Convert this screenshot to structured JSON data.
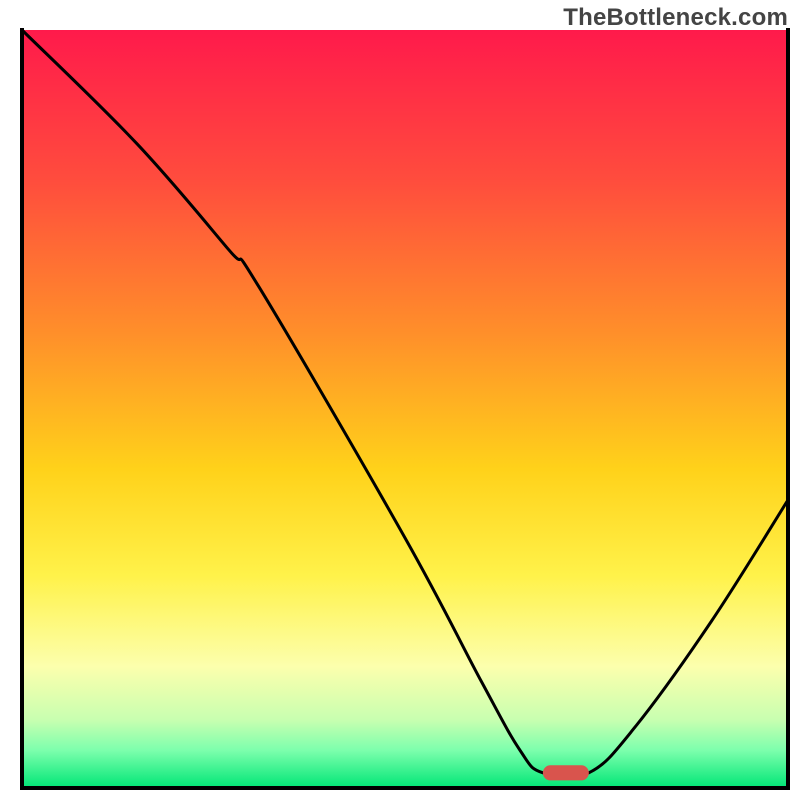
{
  "watermark": "TheBottleneck.com",
  "chart_data": {
    "type": "line",
    "title": "",
    "xlabel": "",
    "ylabel": "",
    "xlim": [
      0,
      100
    ],
    "ylim": [
      0,
      100
    ],
    "background_gradient": {
      "description": "Vertical gradient from red (top) through orange, yellow, pale yellow, pale green, to saturated green (bottom)",
      "stops": [
        {
          "offset": 0,
          "color": "#ff1a4b"
        },
        {
          "offset": 20,
          "color": "#ff4d3d"
        },
        {
          "offset": 40,
          "color": "#ff8f2a"
        },
        {
          "offset": 58,
          "color": "#ffd21a"
        },
        {
          "offset": 72,
          "color": "#fff24a"
        },
        {
          "offset": 84,
          "color": "#fcffad"
        },
        {
          "offset": 91,
          "color": "#c8ffb0"
        },
        {
          "offset": 95,
          "color": "#7dffad"
        },
        {
          "offset": 100,
          "color": "#00e676"
        }
      ]
    },
    "series": [
      {
        "name": "bottleneck-curve",
        "description": "Black V-shaped curve: steep descent from top-left, slope change near x≈30, minimum flat segment near x≈68–74 at y≈2, then rises to right edge meeting it at y≈38.",
        "points": [
          {
            "x": 0,
            "y": 100
          },
          {
            "x": 15,
            "y": 85
          },
          {
            "x": 27,
            "y": 71
          },
          {
            "x": 31,
            "y": 66
          },
          {
            "x": 50,
            "y": 33
          },
          {
            "x": 60,
            "y": 14
          },
          {
            "x": 65,
            "y": 5
          },
          {
            "x": 68,
            "y": 2
          },
          {
            "x": 74,
            "y": 2
          },
          {
            "x": 80,
            "y": 8
          },
          {
            "x": 90,
            "y": 22
          },
          {
            "x": 100,
            "y": 38
          }
        ]
      }
    ],
    "marker": {
      "name": "optimal-point",
      "description": "Small muted-red rounded capsule at the curve minimum",
      "x": 71,
      "y": 2,
      "width": 6,
      "height": 2,
      "color": "#d9544d"
    },
    "frame": {
      "top": false,
      "right": true,
      "bottom": true,
      "left": true,
      "color": "#000000",
      "width": 4
    }
  }
}
